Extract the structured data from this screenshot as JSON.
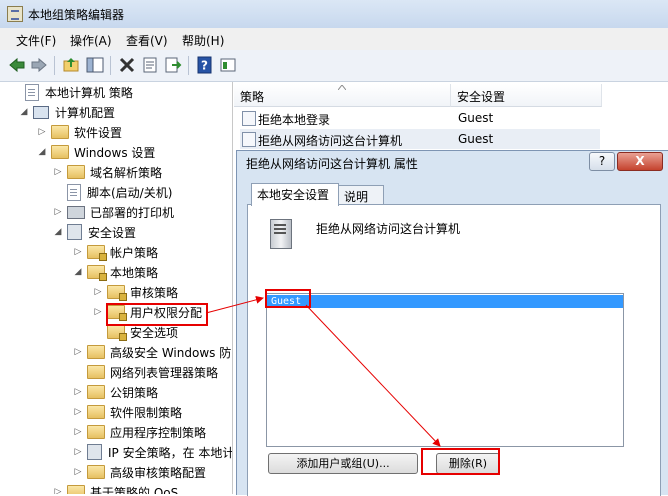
{
  "window": {
    "title": "本地组策略编辑器"
  },
  "menu": [
    "文件(F)",
    "操作(A)",
    "查看(V)",
    "帮助(H)"
  ],
  "toolbar_icons": [
    "back-icon",
    "forward-icon",
    "up-folder-icon",
    "show-hide-tree-icon",
    "delete-icon",
    "properties-icon",
    "export-icon",
    "help-icon",
    "view-icon"
  ],
  "tree": [
    {
      "label": "本地计算机 策略",
      "icon": "doc",
      "level": 0,
      "twisty": ""
    },
    {
      "label": "计算机配置",
      "icon": "pc",
      "level": 1,
      "twisty": "◢"
    },
    {
      "label": "软件设置",
      "icon": "folder",
      "level": 2,
      "twisty": "▷"
    },
    {
      "label": "Windows 设置",
      "icon": "folder",
      "level": 2,
      "twisty": "◢"
    },
    {
      "label": "域名解析策略",
      "icon": "folder",
      "level": 3,
      "twisty": "▷"
    },
    {
      "label": "脚本(启动/关机)",
      "icon": "doc",
      "level": 3,
      "twisty": ""
    },
    {
      "label": "已部署的打印机",
      "icon": "printer",
      "level": 3,
      "twisty": "▷"
    },
    {
      "label": "安全设置",
      "icon": "shield",
      "level": 3,
      "twisty": "◢"
    },
    {
      "label": "帐户策略",
      "icon": "lockfolder",
      "level": 4,
      "twisty": "▷"
    },
    {
      "label": "本地策略",
      "icon": "lockfolder",
      "level": 4,
      "twisty": "◢"
    },
    {
      "label": "审核策略",
      "icon": "lockfolder",
      "level": 5,
      "twisty": "▷"
    },
    {
      "label": "用户权限分配",
      "icon": "lockfolder",
      "level": 5,
      "twisty": "▷"
    },
    {
      "label": "安全选项",
      "icon": "lockfolder",
      "level": 5,
      "twisty": ""
    },
    {
      "label": "高级安全 Windows 防",
      "icon": "folder",
      "level": 4,
      "twisty": "▷"
    },
    {
      "label": "网络列表管理器策略",
      "icon": "folder",
      "level": 4,
      "twisty": ""
    },
    {
      "label": "公钥策略",
      "icon": "folder",
      "level": 4,
      "twisty": "▷"
    },
    {
      "label": "软件限制策略",
      "icon": "folder",
      "level": 4,
      "twisty": "▷"
    },
    {
      "label": "应用程序控制策略",
      "icon": "folder",
      "level": 4,
      "twisty": "▷"
    },
    {
      "label": "IP 安全策略，在 本地计",
      "icon": "shield",
      "level": 4,
      "twisty": "▷"
    },
    {
      "label": "高级审核策略配置",
      "icon": "folder",
      "level": 4,
      "twisty": "▷"
    },
    {
      "label": "基于策略的 QoS",
      "icon": "folder",
      "level": 3,
      "twisty": "▷"
    }
  ],
  "list": {
    "col_policy": "策略",
    "col_setting": "安全设置",
    "rows": [
      {
        "name": "拒绝本地登录",
        "value": "Guest"
      },
      {
        "name": "拒绝从网络访问这台计算机",
        "value": "Guest"
      }
    ]
  },
  "dialog": {
    "title": "拒绝从网络访问这台计算机 属性",
    "help": "?",
    "close": "X",
    "tabs": [
      "本地安全设置",
      "说明"
    ],
    "heading": "拒绝从网络访问这台计算机",
    "members": [
      "Guest"
    ],
    "add_button": "添加用户或组(U)...",
    "remove_button": "删除(R)"
  },
  "annotation_color": "#e60000"
}
